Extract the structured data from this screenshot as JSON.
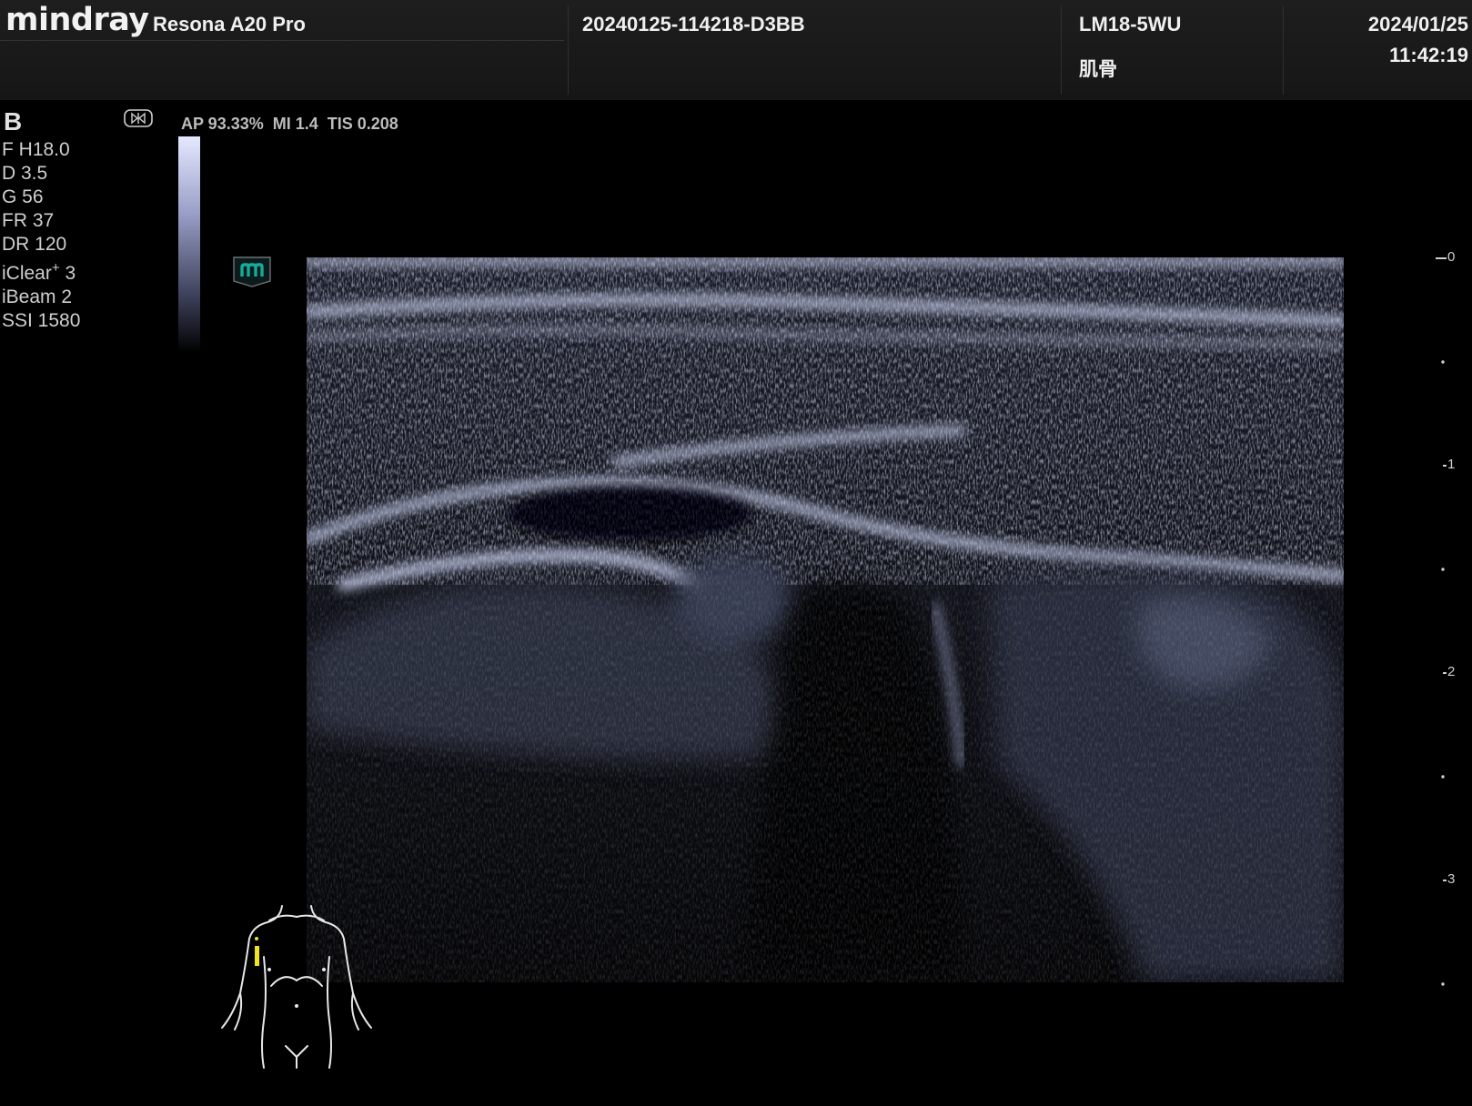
{
  "header": {
    "brand": "mindray",
    "model": "Resona A20 Pro",
    "patient_id": "20240125-114218-D3BB",
    "probe": "LM18-5WU",
    "exam": "肌骨",
    "date": "2024/01/25",
    "time": "11:42:19"
  },
  "params": {
    "mode": "B",
    "freq": "F H18.0",
    "depth": "D 3.5",
    "gain": "G 56",
    "frame_rate": "FR 37",
    "dynamic_range": "DR 120",
    "iclear_prefix": "iClear",
    "iclear_sup": "+",
    "iclear_value": " 3",
    "ibeam": "iBeam 2",
    "ssi": "SSI 1580"
  },
  "acoustic": {
    "ap": "AP 93.33%",
    "mi": "MI 1.4",
    "tis": "TIS 0.208"
  },
  "depth_scale": {
    "labels": [
      "0",
      "1",
      "2",
      "3"
    ],
    "unit_ticks": "cm"
  },
  "colors": {
    "header_bg": "#1b1b1b",
    "tissue_tint": "#9aa2c8",
    "probe_mark": "#18a99a",
    "body_marker": "#f1e21c"
  },
  "icons": {
    "orientation": "orientation-marker-icon",
    "probe_mark": "probe-side-mark-icon",
    "body_marker": "body-marker-icon"
  }
}
